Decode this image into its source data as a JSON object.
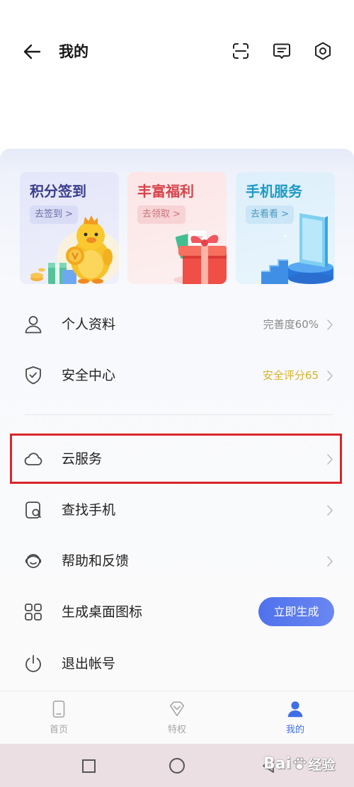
{
  "header": {
    "title": "我的",
    "back_icon": "arrow-left-icon",
    "actions": [
      "scan-icon",
      "message-icon",
      "settings-icon"
    ]
  },
  "promo_cards": [
    {
      "title": "积分签到",
      "button": "去签到 >",
      "title_color": "#3a3e8c",
      "illustration": "mascot-coin-illustration"
    },
    {
      "title": "丰富福利",
      "button": "去领取 >",
      "title_color": "#d8424a",
      "illustration": "gift-box-illustration"
    },
    {
      "title": "手机服务",
      "button": "去看看 >",
      "title_color": "#1d9bc6",
      "illustration": "phone-stand-illustration"
    }
  ],
  "menu": {
    "profile": {
      "label": "个人资料",
      "status": "完善度60%",
      "status_color": "#8a8a8a",
      "icon": "person-icon"
    },
    "security": {
      "label": "安全中心",
      "status": "安全评分65",
      "status_color": "#d6b22a",
      "icon": "shield-check-icon"
    },
    "cloud": {
      "label": "云服务",
      "icon": "cloud-icon"
    },
    "find_phone": {
      "label": "查找手机",
      "icon": "phone-search-icon"
    },
    "help": {
      "label": "帮助和反馈",
      "icon": "support-face-icon"
    },
    "desktop_shortcut": {
      "label": "生成桌面图标",
      "button": "立即生成",
      "icon": "grid-icon"
    },
    "logout": {
      "label": "退出帐号",
      "icon": "power-icon"
    }
  },
  "highlight": {
    "color": "#d7262c"
  },
  "bottom_nav": [
    {
      "label": "首页",
      "icon": "phone-icon",
      "active": false
    },
    {
      "label": "特权",
      "icon": "diamond-icon",
      "active": false
    },
    {
      "label": "我的",
      "icon": "person-filled-icon",
      "active": true
    }
  ],
  "system_nav": [
    "square-recents-icon",
    "circle-home-icon",
    "triangle-back-icon"
  ],
  "watermark": {
    "brand": "Bai",
    "suffix": "经验"
  },
  "colors": {
    "accent": "#3f6fe6",
    "button": "#5a7bef",
    "chevron": "#bcbcbc"
  }
}
